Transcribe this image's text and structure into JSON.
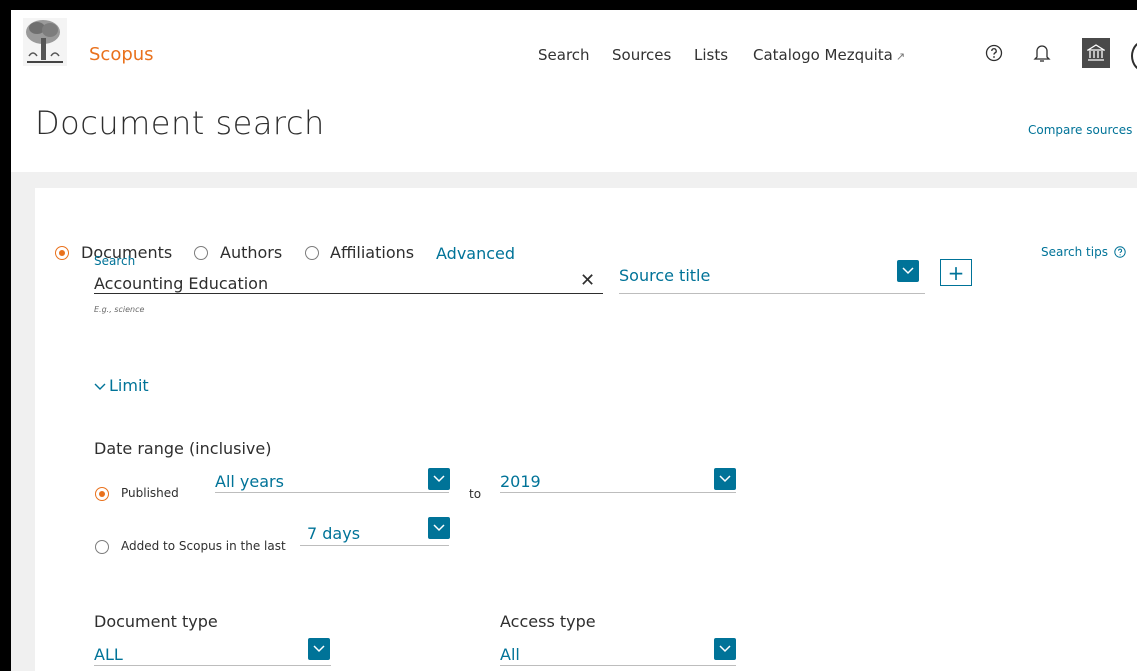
{
  "header": {
    "brand": "Scopus",
    "nav": [
      "Search",
      "Sources",
      "Lists",
      "Catalogo Mezquita"
    ],
    "external_glyph": "↗",
    "icons": [
      "help-icon",
      "bell-icon",
      "institution-icon",
      "user-avatar"
    ]
  },
  "page": {
    "title": "Document search",
    "compare_sources": "Compare sources"
  },
  "search_panel": {
    "tabs": [
      "Documents",
      "Authors",
      "Affiliations"
    ],
    "selected_tab": "Documents",
    "advanced": "Advanced",
    "search_tips": "Search tips",
    "search_label": "Search",
    "search_value": "Accounting Education",
    "search_hint": "E.g., science",
    "field_select": "Source title",
    "add_field": "+"
  },
  "limit": {
    "toggle": "Limit",
    "date_range_label": "Date range (inclusive)",
    "published_label": "Published",
    "from_value": "All years",
    "to_label": "to",
    "to_value": "2019",
    "added_label": "Added to Scopus in the last",
    "added_value": "7 days",
    "doc_type_label": "Document type",
    "doc_type_value": "ALL",
    "access_type_label": "Access type",
    "access_type_value": "All"
  },
  "colors": {
    "brand": "#e9711c",
    "link": "#007398",
    "panel_bg": "#f0f0f0"
  }
}
